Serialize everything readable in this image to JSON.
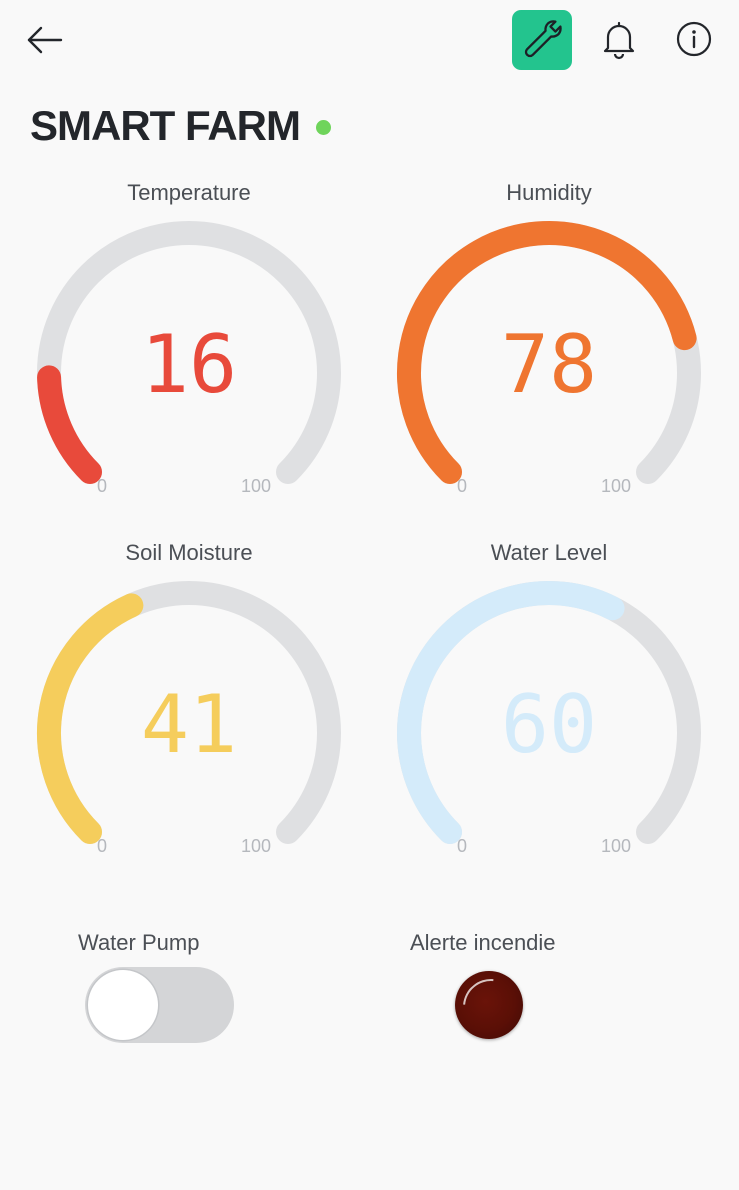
{
  "header": {
    "back_icon": "arrow-left-icon",
    "wrench_icon": "wrench-icon",
    "bell_icon": "bell-icon",
    "info_icon": "info-icon",
    "accent_color": "#23c48e"
  },
  "title": "SMART FARM",
  "status_color": "#6fd45b",
  "gauges": [
    {
      "label": "Temperature",
      "value": "16",
      "min": "0",
      "max": "100",
      "fraction": 0.16,
      "color": "#e84a3b"
    },
    {
      "label": "Humidity",
      "value": "78",
      "min": "0",
      "max": "100",
      "fraction": 0.78,
      "color": "#ef7530"
    },
    {
      "label": "Soil Moisture",
      "value": "41",
      "min": "0",
      "max": "100",
      "fraction": 0.41,
      "color": "#f5cd5c"
    },
    {
      "label": "Water Level",
      "value": "60",
      "min": "0",
      "max": "100",
      "fraction": 0.6,
      "color": "#d4ebfa"
    }
  ],
  "track_color": "#dfe0e2",
  "controls": {
    "pump_label": "Water Pump",
    "pump_on": false,
    "alert_label": "Alerte incendie",
    "alert_color": "#561006"
  }
}
